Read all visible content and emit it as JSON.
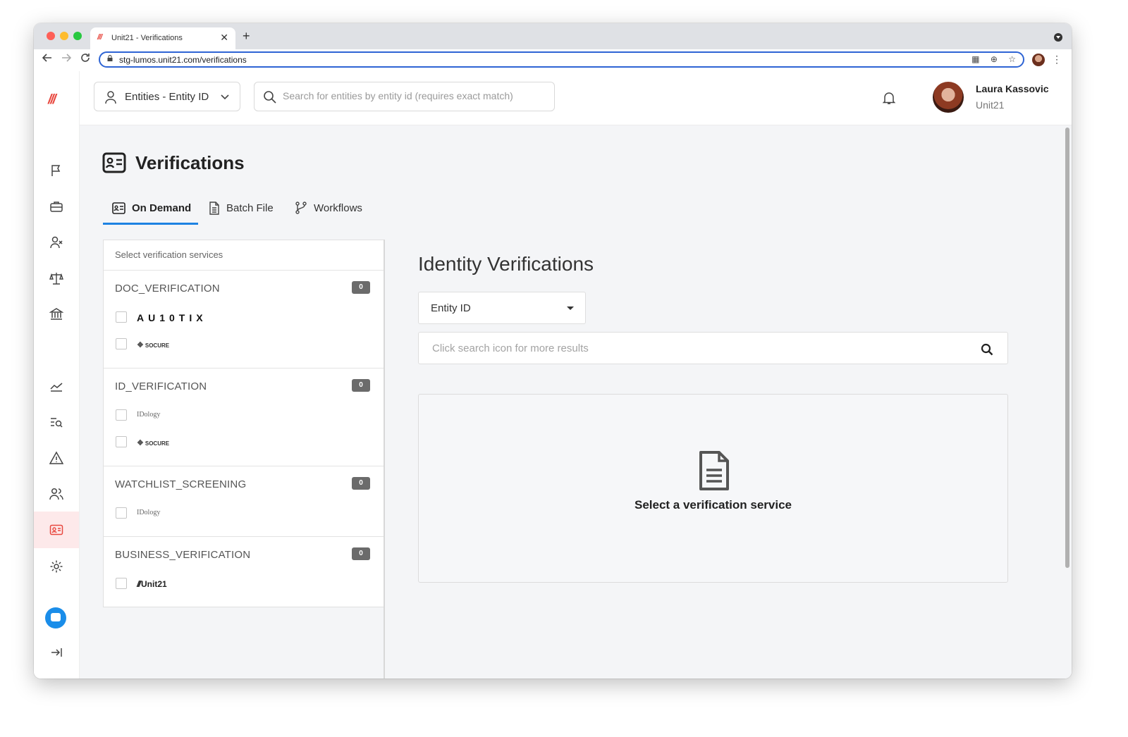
{
  "browser": {
    "tab_title": "Unit21 - Verifications",
    "tab_favicon": "///",
    "tab_close": "✕",
    "new_tab": "+",
    "url": "stg-lumos.unit21.com/verifications"
  },
  "app": {
    "logo": "///",
    "entity_selector": {
      "label": "Entities - Entity ID",
      "icon": "person-icon"
    },
    "global_search": {
      "placeholder": "Search for entities by entity id (requires exact match)"
    },
    "user": {
      "name": "Laura Kassovic",
      "org": "Unit21"
    },
    "sidebar": {
      "items": [
        {
          "icon": "flag-icon"
        },
        {
          "icon": "briefcase-icon"
        },
        {
          "icon": "user-x-icon"
        },
        {
          "icon": "scales-icon"
        },
        {
          "icon": "bank-icon"
        },
        {
          "icon": "trending-icon"
        },
        {
          "icon": "list-search-icon"
        },
        {
          "icon": "alert-triangle-icon"
        },
        {
          "icon": "users-icon"
        },
        {
          "icon": "id-card-icon",
          "active": true
        },
        {
          "icon": "gear-icon"
        },
        {
          "icon": "chat-icon"
        },
        {
          "icon": "expand-arrow-icon"
        }
      ],
      "active_color": "#fde9ea"
    }
  },
  "page": {
    "title": "Verifications",
    "tabs": [
      {
        "label": "On Demand",
        "icon": "id-card-icon",
        "active": true
      },
      {
        "label": "Batch File",
        "icon": "file-icon",
        "active": false
      },
      {
        "label": "Workflows",
        "icon": "workflow-icon",
        "active": false
      }
    ],
    "accent_color": "#1d82e2"
  },
  "services": {
    "header": "Select verification services",
    "groups": [
      {
        "title": "DOC_VERIFICATION",
        "count": "0",
        "vendors": [
          "AU10TIX",
          "SOCURE"
        ]
      },
      {
        "title": "ID_VERIFICATION",
        "count": "0",
        "vendors": [
          "IDology",
          "SOCURE"
        ]
      },
      {
        "title": "WATCHLIST_SCREENING",
        "count": "0",
        "vendors": [
          "IDology"
        ]
      },
      {
        "title": "BUSINESS_VERIFICATION",
        "count": "0",
        "vendors": [
          "Unit21"
        ]
      }
    ]
  },
  "identity": {
    "title": "Identity Verifications",
    "type_select": "Entity ID",
    "search_placeholder": "Click search icon for more results",
    "empty_message": "Select a verification service"
  }
}
